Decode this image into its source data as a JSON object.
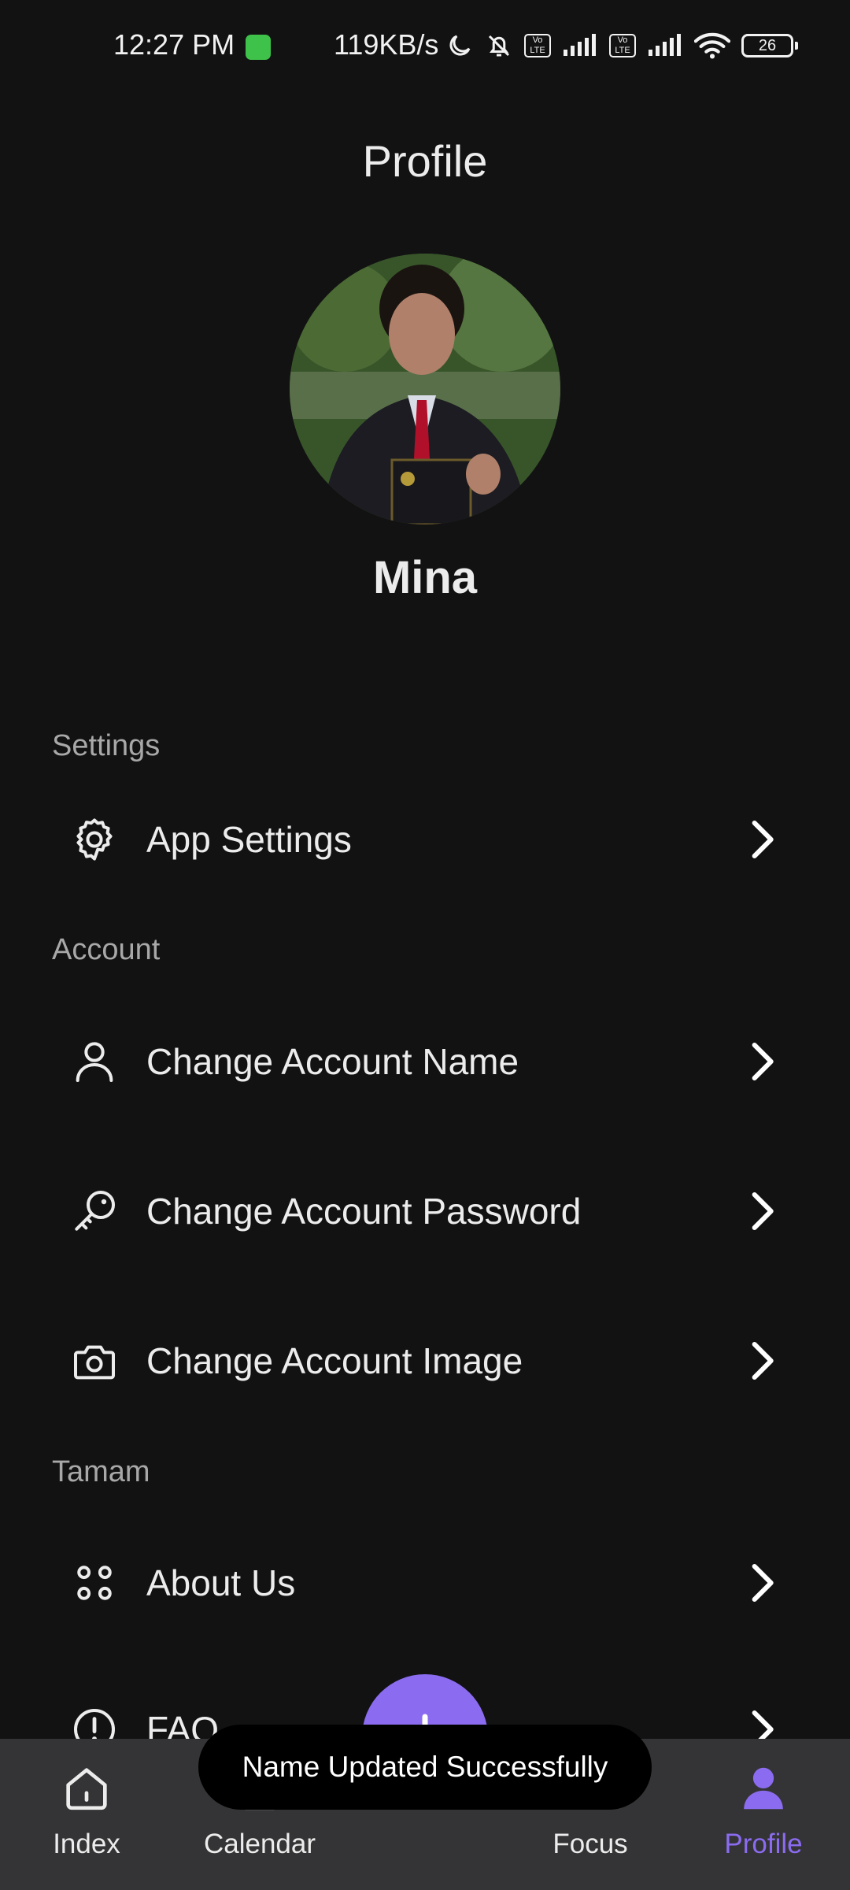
{
  "status_bar": {
    "time": "12:27 PM",
    "net_speed": "119KB/s",
    "volte_label": "Vo LTE",
    "battery": "26",
    "icons": [
      "cat-app-icon",
      "moon-icon",
      "bell-off-icon",
      "volte-icon",
      "signal-icon",
      "volte-icon",
      "signal-icon",
      "wifi-icon",
      "battery-icon"
    ]
  },
  "header": {
    "title": "Profile"
  },
  "profile": {
    "name": "Mina",
    "avatar": "profile-photo"
  },
  "sections": {
    "settings": {
      "label": "Settings",
      "items": [
        {
          "label": "App Settings",
          "icon": "gear-icon"
        }
      ]
    },
    "account": {
      "label": "Account",
      "items": [
        {
          "label": "Change Account Name",
          "icon": "user-icon"
        },
        {
          "label": "Change Account Password",
          "icon": "key-icon"
        },
        {
          "label": "Change Account Image",
          "icon": "camera-icon"
        }
      ]
    },
    "tamam": {
      "label": "Tamam",
      "items": [
        {
          "label": "About Us",
          "icon": "dots-grid-icon"
        },
        {
          "label": "FAQ",
          "icon": "info-circle-icon"
        }
      ]
    }
  },
  "bottom_nav": {
    "items": [
      {
        "label": "Index",
        "icon": "home-icon"
      },
      {
        "label": "Calendar",
        "icon": "calendar-icon"
      },
      {
        "label": "Focus",
        "icon": "focus-icon"
      },
      {
        "label": "Profile",
        "icon": "profile-icon",
        "active": true
      }
    ]
  },
  "fab": {
    "icon": "plus-icon"
  },
  "toast": {
    "message": "Name Updated Successfully"
  },
  "colors": {
    "background": "#121213",
    "accent": "#8b6cf0",
    "nav_background": "#343436",
    "toast_background": "#000000"
  }
}
